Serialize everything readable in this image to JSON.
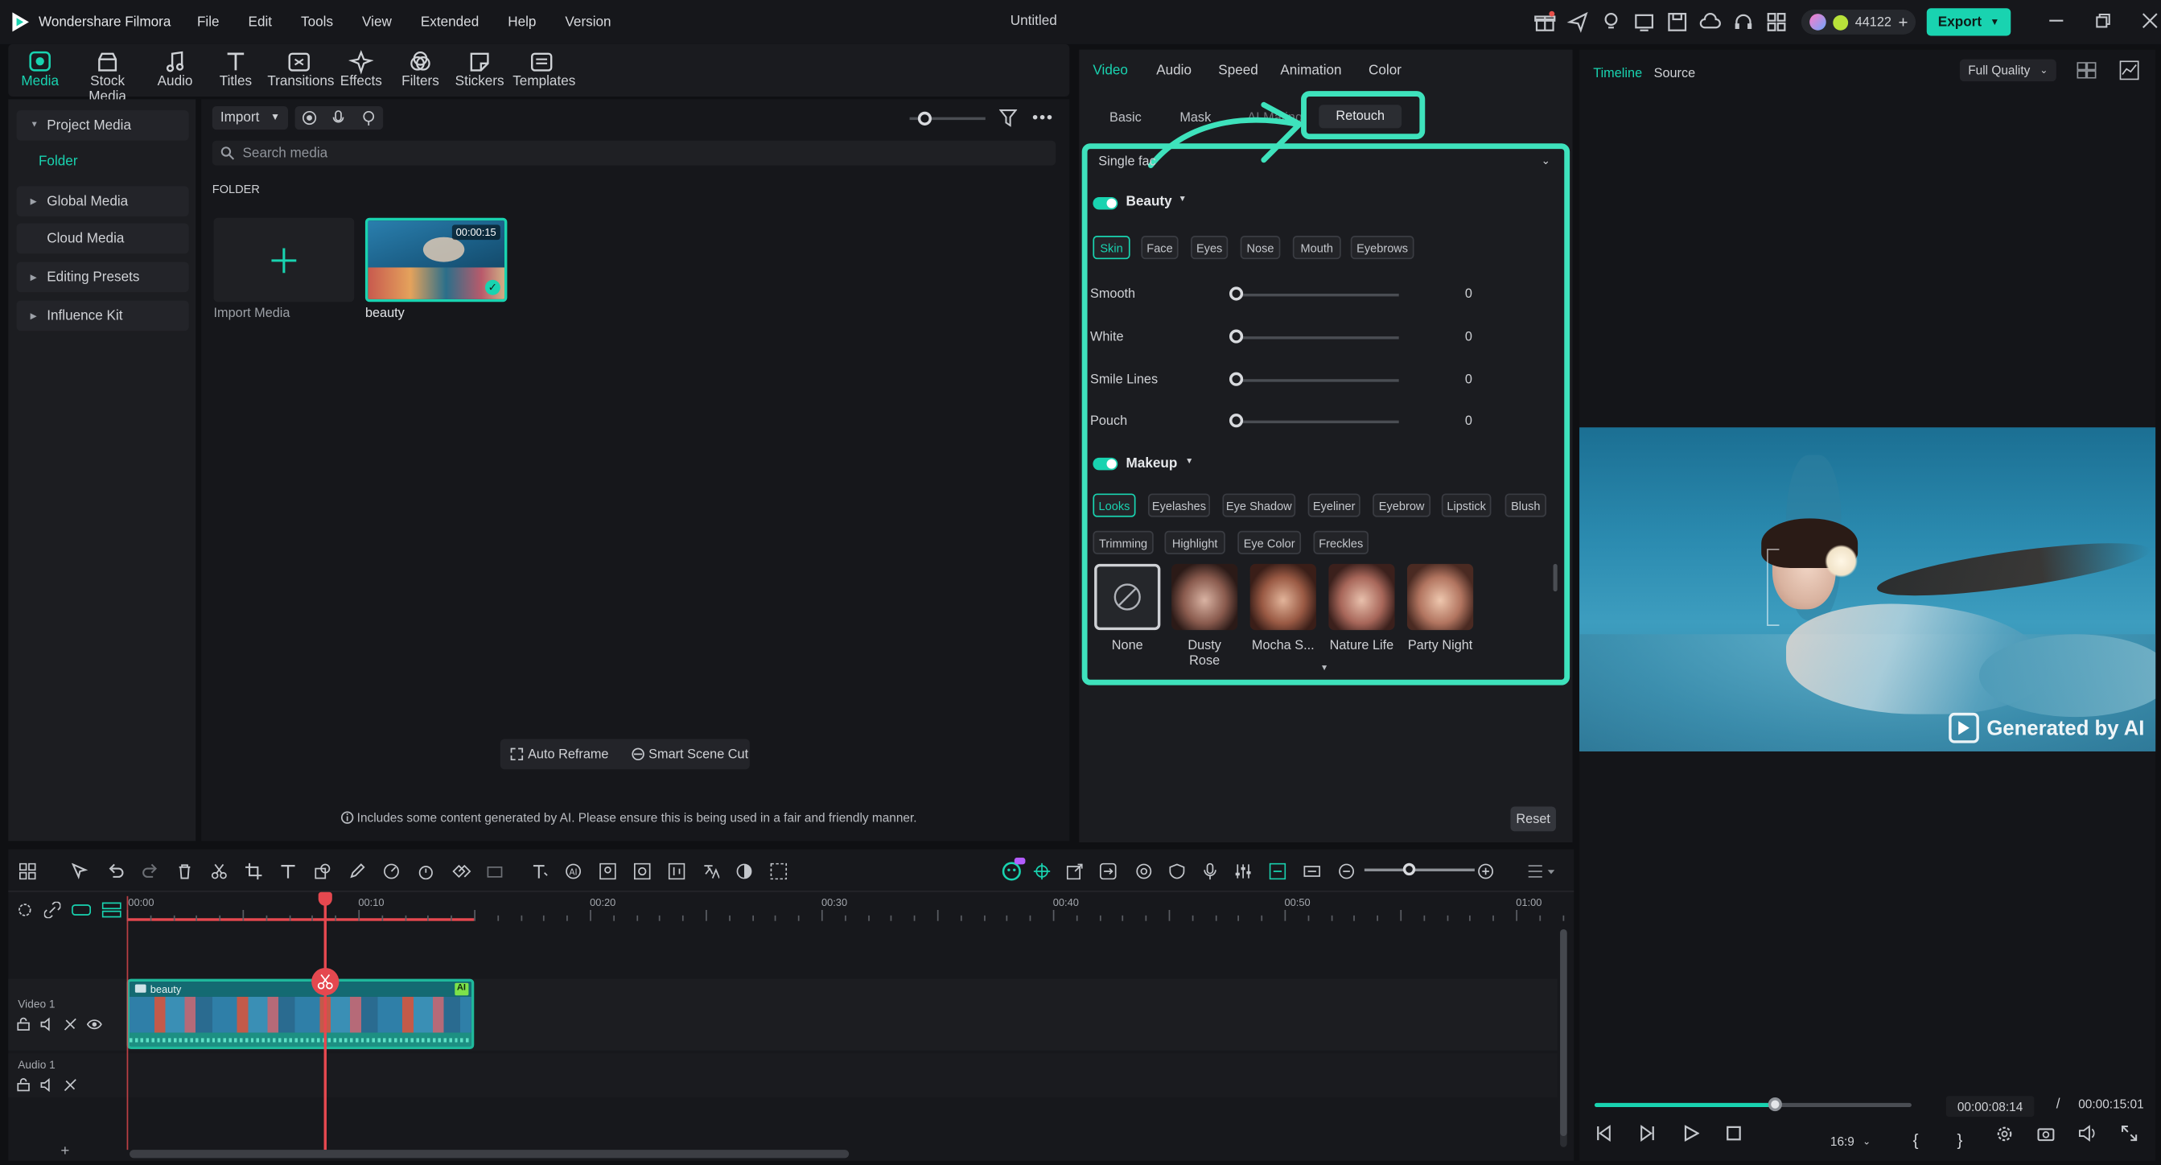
{
  "app": {
    "name": "Wondershare Filmora",
    "project_title": "Untitled",
    "menu": [
      "File",
      "Edit",
      "Tools",
      "View",
      "Extended",
      "Help",
      "Version"
    ],
    "credits": "44122",
    "export_label": "Export"
  },
  "toolbar": [
    {
      "label": "Media",
      "icon": "media-icon"
    },
    {
      "label": "Stock Media",
      "icon": "stock-media-icon"
    },
    {
      "label": "Audio",
      "icon": "audio-icon"
    },
    {
      "label": "Titles",
      "icon": "titles-icon"
    },
    {
      "label": "Transitions",
      "icon": "transitions-icon"
    },
    {
      "label": "Effects",
      "icon": "effects-icon"
    },
    {
      "label": "Filters",
      "icon": "filters-icon"
    },
    {
      "label": "Stickers",
      "icon": "stickers-icon"
    },
    {
      "label": "Templates",
      "icon": "templates-icon"
    }
  ],
  "sidebar": {
    "project_media": "Project Media",
    "folder": "Folder",
    "global_media": "Global Media",
    "cloud_media": "Cloud Media",
    "editing_presets": "Editing Presets",
    "influence_kit": "Influence Kit"
  },
  "media": {
    "import_label": "Import",
    "search_placeholder": "Search media",
    "folder_heading": "FOLDER",
    "import_media_label": "Import Media",
    "clip_name": "beauty",
    "clip_duration": "00:00:15",
    "auto_reframe": "Auto Reframe",
    "smart_scene_cut": "Smart Scene Cut",
    "ai_notice": "Includes some content generated by AI. Please ensure this is being used in a fair and friendly manner."
  },
  "props": {
    "tabs": [
      "Video",
      "Audio",
      "Speed",
      "Animation",
      "Color"
    ],
    "subtabs": [
      "Basic",
      "Mask",
      "AI Mating",
      "Retouch"
    ],
    "face_mode": "Single fac",
    "beauty_label": "Beauty",
    "beauty_chips": [
      "Skin",
      "Face",
      "Eyes",
      "Nose",
      "Mouth",
      "Eyebrows"
    ],
    "sliders": [
      {
        "label": "Smooth",
        "value": "0"
      },
      {
        "label": "White",
        "value": "0"
      },
      {
        "label": "Smile Lines",
        "value": "0"
      },
      {
        "label": "Pouch",
        "value": "0"
      }
    ],
    "makeup_label": "Makeup",
    "makeup_chips_row1": [
      "Looks",
      "Eyelashes",
      "Eye Shadow",
      "Eyeliner",
      "Eyebrow",
      "Lipstick",
      "Blush"
    ],
    "makeup_chips_row2": [
      "Trimming",
      "Highlight",
      "Eye Color",
      "Freckles"
    ],
    "looks": [
      "None",
      "Dusty Rose",
      "Mocha S...",
      "Nature Life",
      "Party Night"
    ],
    "reset_label": "Reset"
  },
  "preview": {
    "tab_timeline": "Timeline",
    "tab_source": "Source",
    "quality": "Full Quality",
    "watermark": "Generated by AI",
    "current_time": "00:00:08:14",
    "separator": "/",
    "total_time": "00:00:15:01",
    "aspect": "16:9",
    "progress": 0.57
  },
  "timeline": {
    "ticks": [
      "00:00",
      "00:10",
      "00:20",
      "00:30",
      "00:40",
      "00:50",
      "01:00"
    ],
    "video_track": "Video 1",
    "audio_track": "Audio 1",
    "clip_label": "beauty",
    "ai_badge": "AI"
  }
}
